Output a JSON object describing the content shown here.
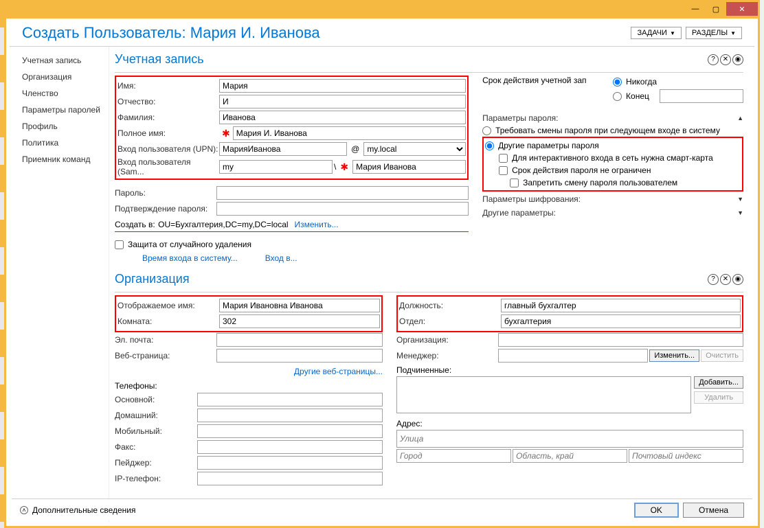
{
  "header": {
    "title": "Создать Пользователь: Мария И. Иванова",
    "tasks_btn": "ЗАДАЧИ",
    "sections_btn": "РАЗДЕЛЫ"
  },
  "sidebar": {
    "items": [
      "Учетная запись",
      "Организация",
      "Членство",
      "Параметры паролей",
      "Профиль",
      "Политика",
      "Приемник команд"
    ]
  },
  "account": {
    "section_title": "Учетная запись",
    "first_name_label": "Имя:",
    "first_name": "Мария",
    "middle_label": "Отчество:",
    "middle": "И",
    "last_label": "Фамилия:",
    "last": "Иванова",
    "full_label": "Полное имя:",
    "full": "Мария И. Иванова",
    "upn_label": "Вход пользователя (UPN):",
    "upn": "МарияИванова",
    "upn_domain": "my.local",
    "sam_label": "Вход пользователя (Sam...",
    "sam_domain": "my",
    "sam_user": "Мария Иванова",
    "password_label": "Пароль:",
    "confirm_label": "Подтверждение пароля:",
    "create_in_label": "Создать в:",
    "create_in_value": "OU=Бухгалтерия,DC=my,DC=local",
    "change_link": "Изменить...",
    "protect_label": "Защита от случайного удаления",
    "logon_hours": "Время входа в систему...",
    "logon_to": "Вход в...",
    "expiry_label": "Срок действия учетной зап",
    "never": "Никогда",
    "end": "Конец",
    "pwd_params_label": "Параметры пароля:",
    "require_change": "Требовать смены пароля при следующем входе в систему",
    "other_params": "Другие параметры пароля",
    "smartcard": "Для интерактивного входа в сеть нужна смарт-карта",
    "no_expire": "Срок действия пароля не ограничен",
    "no_change": "Запретить смену пароля пользователем",
    "encryption_label": "Параметры шифрования:",
    "other_label": "Другие параметры:"
  },
  "org": {
    "section_title": "Организация",
    "display_label": "Отображаемое имя:",
    "display": "Мария Ивановна Иванова",
    "room_label": "Комната:",
    "room": "302",
    "email_label": "Эл. почта:",
    "web_label": "Веб-страница:",
    "other_web": "Другие веб-страницы...",
    "phones_label": "Телефоны:",
    "phone_main": "Основной:",
    "phone_home": "Домашний:",
    "phone_mobile": "Мобильный:",
    "phone_fax": "Факс:",
    "phone_pager": "Пейджер:",
    "phone_ip": "IP-телефон:",
    "title_label": "Должность:",
    "title": "главный бухгалтер",
    "dept_label": "Отдел:",
    "dept": "бухгалтерия",
    "org_label": "Организация:",
    "manager_label": "Менеджер:",
    "change_btn": "Изменить...",
    "clear_btn": "Очистить",
    "reports_label": "Подчиненные:",
    "add_btn": "Добавить...",
    "remove_btn": "Удалить",
    "address_label": "Адрес:",
    "street_ph": "Улица",
    "city_ph": "Город",
    "region_ph": "Область, край",
    "zip_ph": "Почтовый индекс"
  },
  "footer": {
    "more": "Дополнительные сведения",
    "ok": "OK",
    "cancel": "Отмена"
  }
}
